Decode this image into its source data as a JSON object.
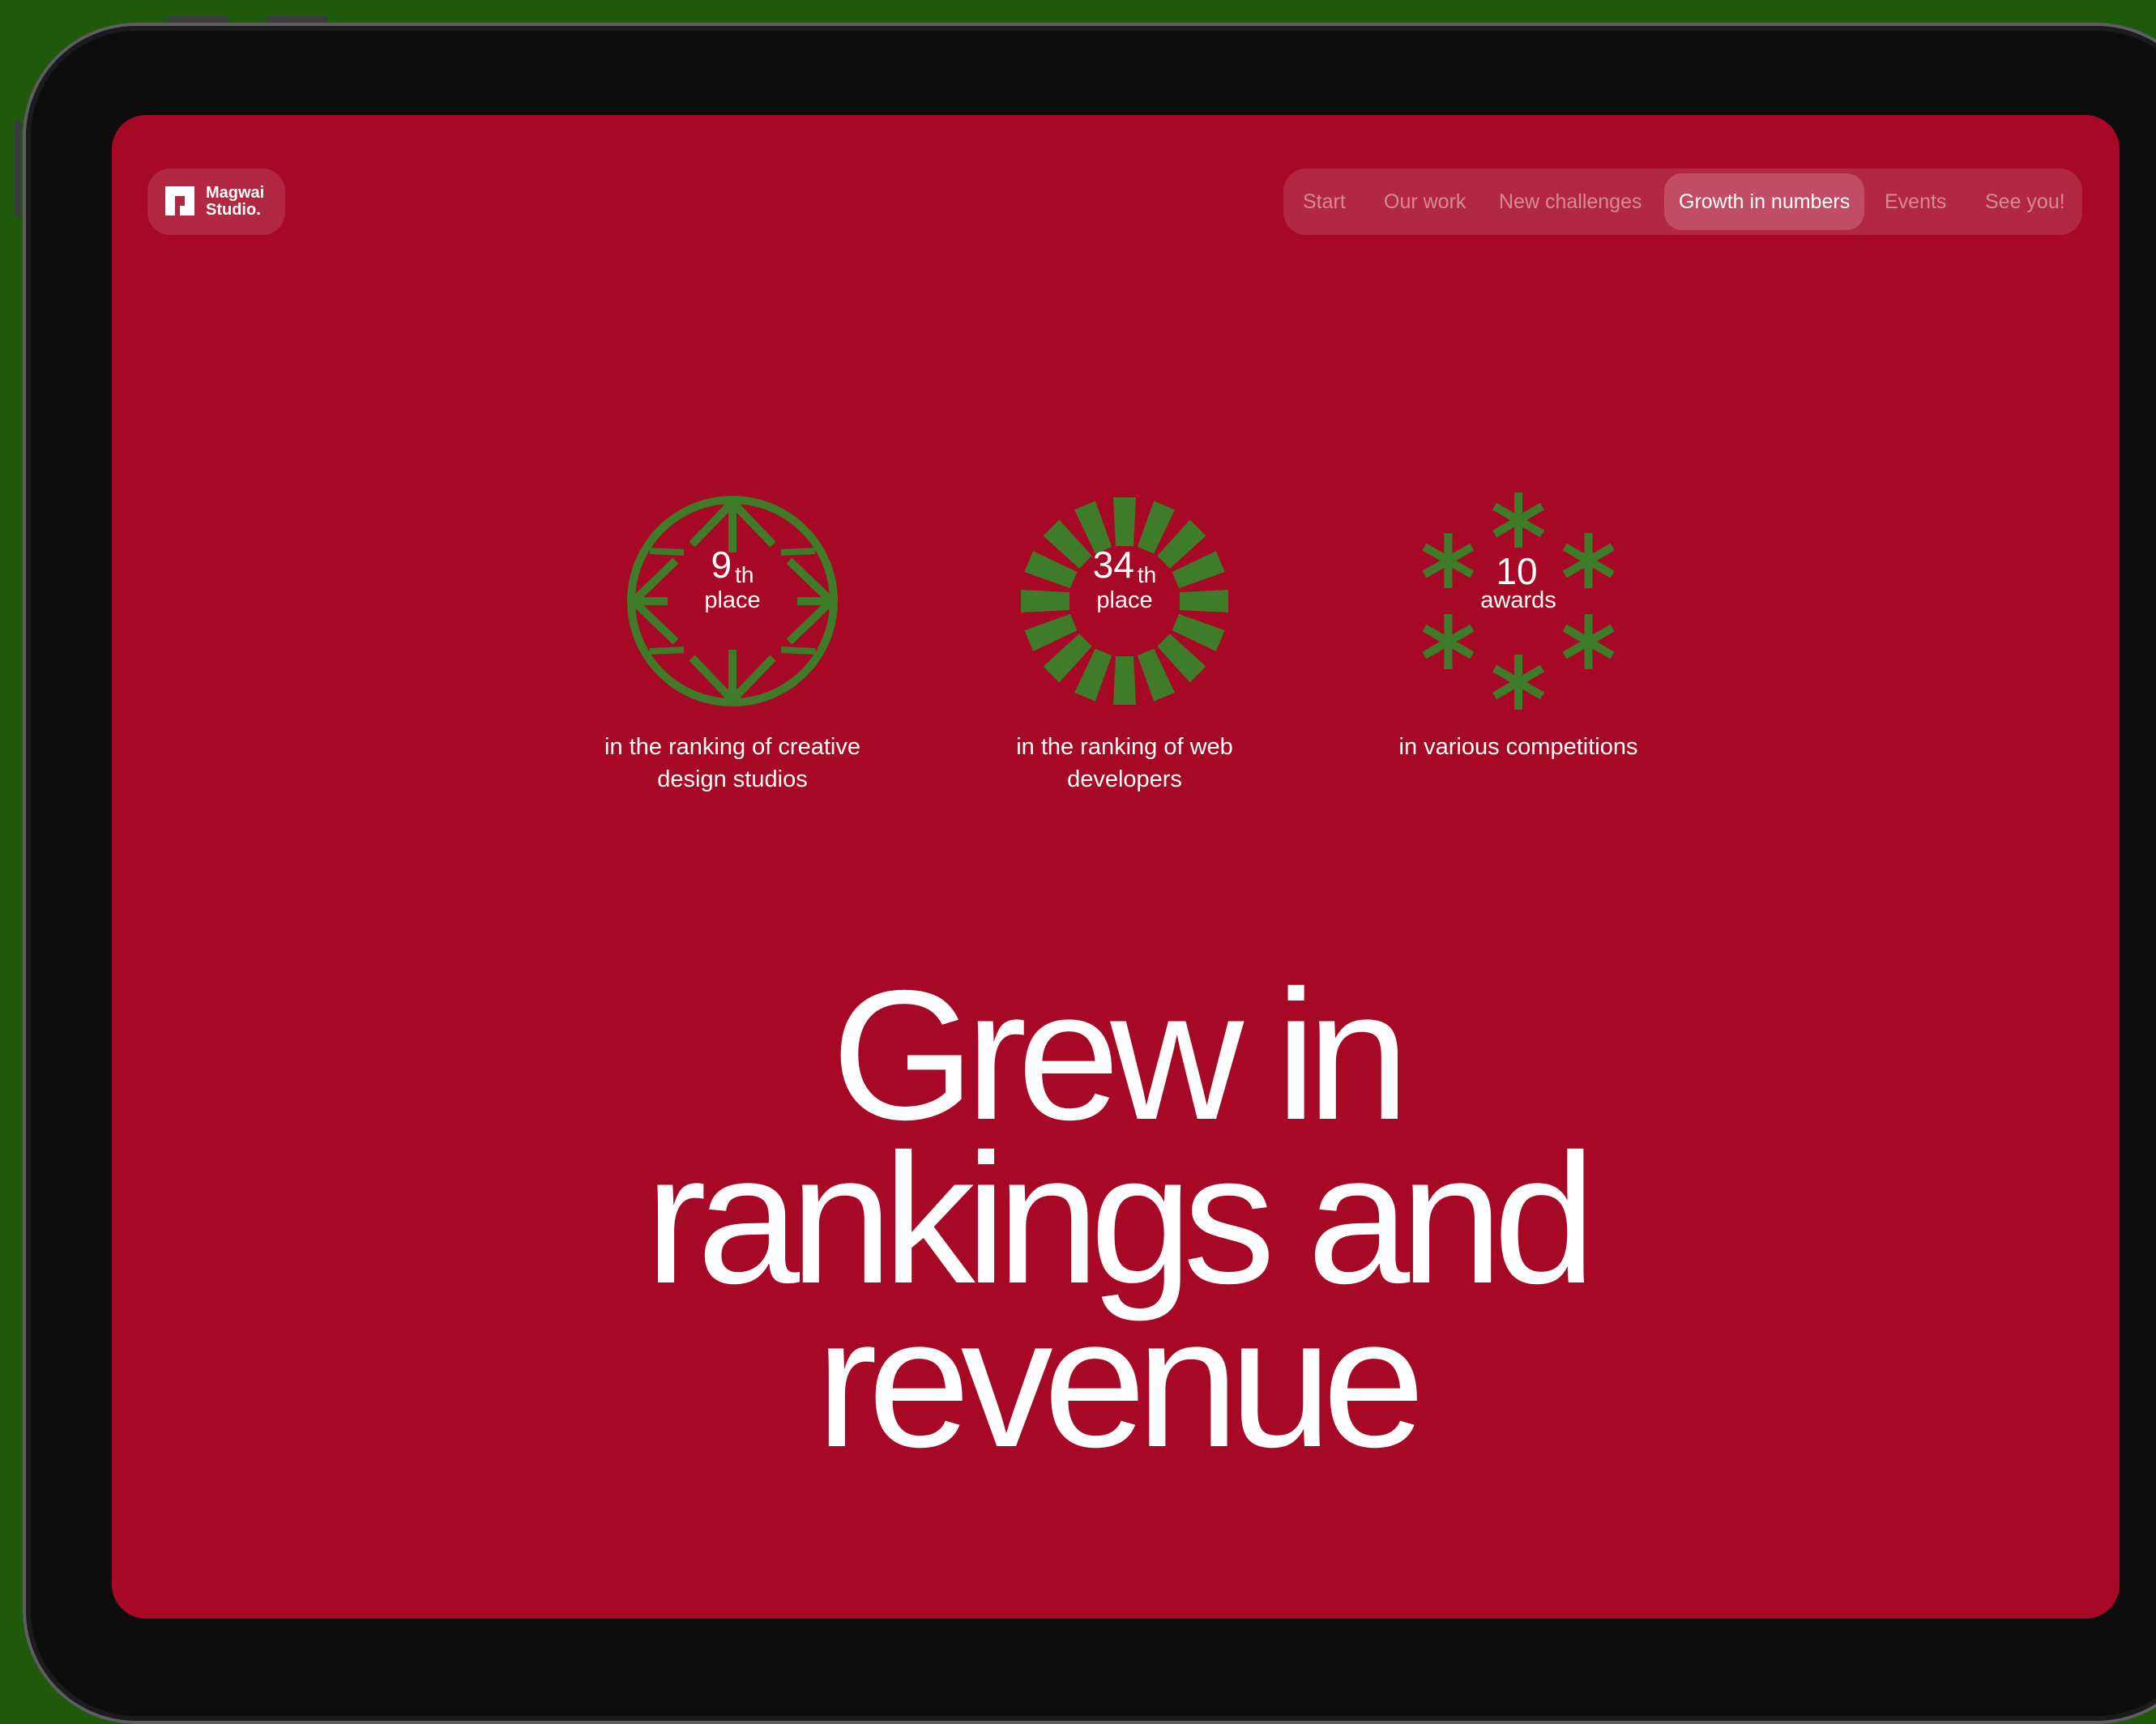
{
  "logo": {
    "line1": "Magwai",
    "line2": "Studio."
  },
  "nav": {
    "items": [
      {
        "label": "Start"
      },
      {
        "label": "Our work"
      },
      {
        "label": "New challenges"
      },
      {
        "label": "Growth in numbers",
        "active": true
      },
      {
        "label": "Events"
      },
      {
        "label": "See you!"
      }
    ]
  },
  "stats": [
    {
      "number": "9",
      "suffix": "th",
      "unit": "place",
      "description": "in the ranking of creative\ndesign studios",
      "icon": "compass-arrows-icon"
    },
    {
      "number": "34",
      "suffix": "th",
      "unit": "place",
      "description": "in the ranking of web\ndevelopers",
      "icon": "sunburst-icon"
    },
    {
      "number": "10",
      "suffix": "",
      "unit": "awards",
      "description": "in various competitions",
      "icon": "asterisk-ring-icon"
    }
  ],
  "headline": {
    "line1": "Grew in",
    "line2": "rankings and",
    "line3": "revenue"
  },
  "colors": {
    "background": "#a70825",
    "accent_green": "#3f7c2a",
    "outer": "#1f5a0b"
  }
}
